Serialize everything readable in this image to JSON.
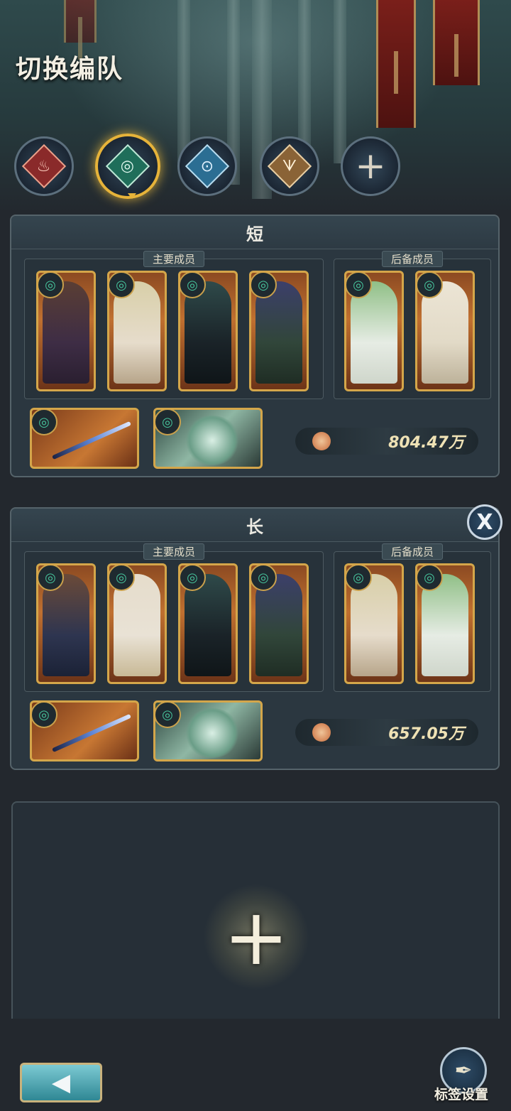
{
  "title": "切换编队",
  "element_tabs": [
    {
      "name": "fire",
      "glyph": "♨",
      "color": "#c9413f"
    },
    {
      "name": "wind",
      "glyph": "◎",
      "color": "#2fa98c"
    },
    {
      "name": "water",
      "glyph": "⊙",
      "color": "#4a9bc6"
    },
    {
      "name": "earth",
      "glyph": "ᗐ",
      "color": "#a07a4b"
    },
    {
      "name": "add",
      "glyph": "+"
    }
  ],
  "teams": [
    {
      "name": "短",
      "main_label": "主要成员",
      "reserve_label": "后备成员",
      "power": "804.47万",
      "main_portraits": [
        "#4a3550",
        "#d8cbb0",
        "#1d2a32",
        "#3c4f3a"
      ],
      "reserve_portraits": [
        "#cfe3c4",
        "#e8e1d2"
      ]
    },
    {
      "name": "长",
      "main_label": "主要成员",
      "reserve_label": "后备成员",
      "power": "657.05万",
      "main_portraits": [
        "#3a2f3e",
        "#ddd2bb",
        "#1d2a32",
        "#3c4f3a"
      ],
      "reserve_portraits": [
        "#d9cfb2",
        "#cfe3c4"
      ]
    }
  ],
  "close_label": "X",
  "add_team_glyph": "+",
  "back_glyph": "◀",
  "tag_settings_label": "标签设置"
}
